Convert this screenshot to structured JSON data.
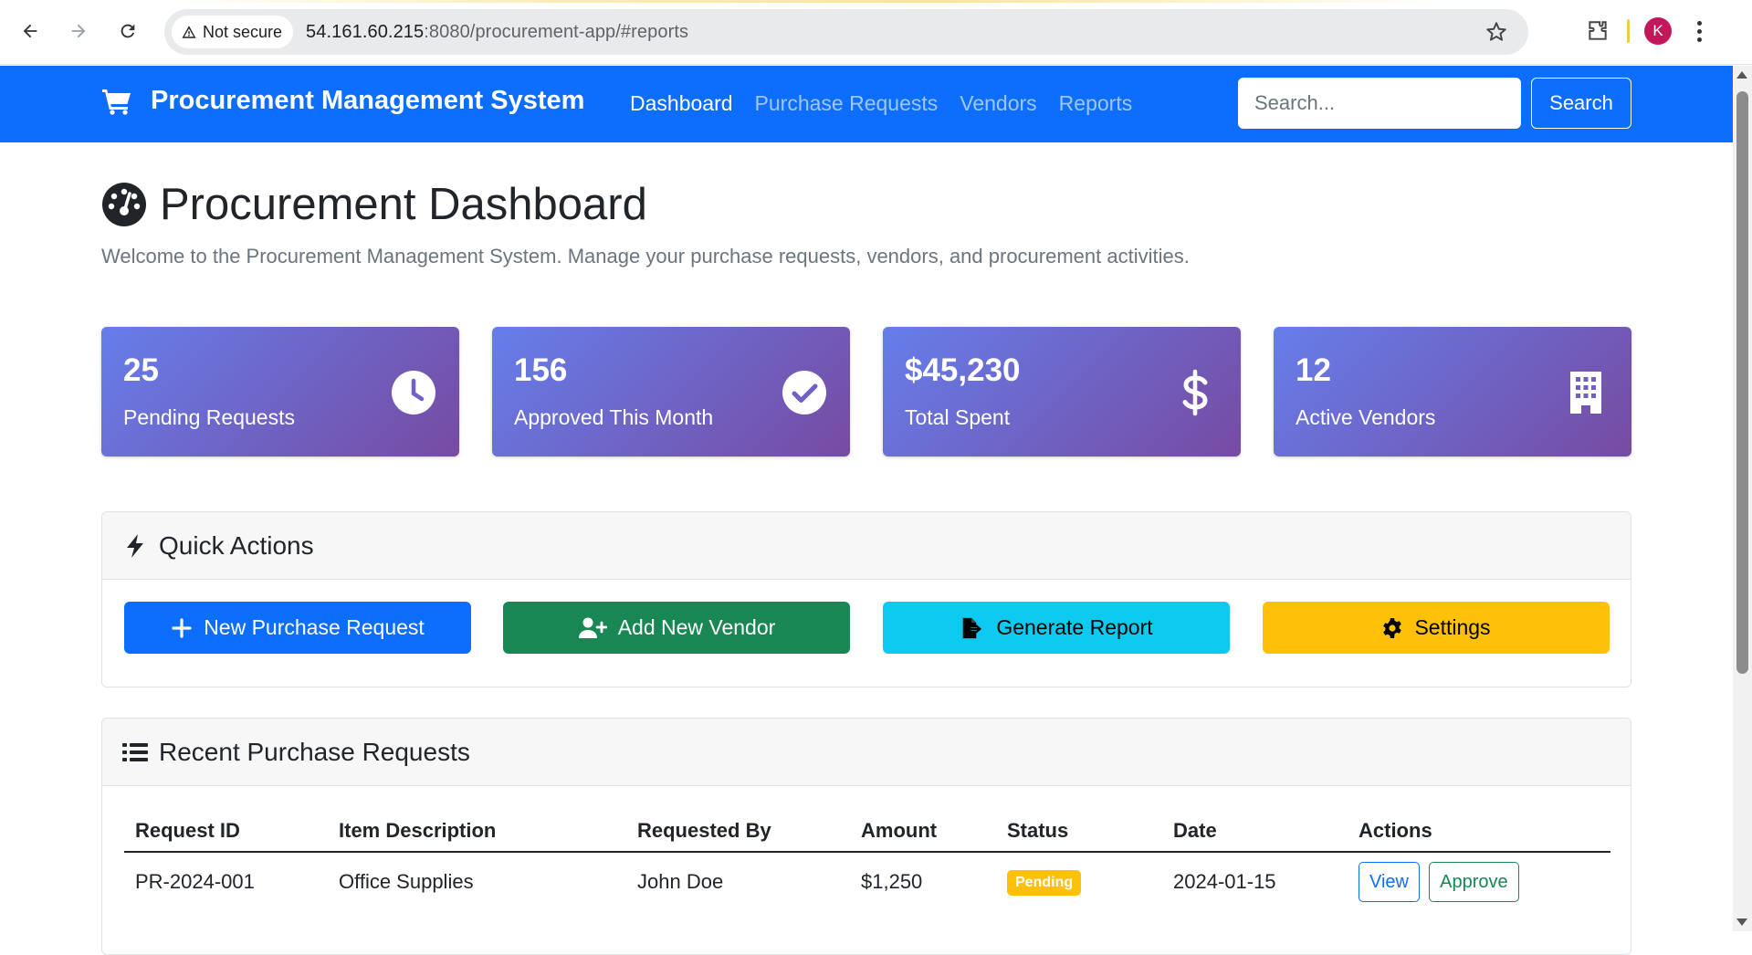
{
  "browser": {
    "security_label": "Not secure",
    "url_host": "54.161.60.215",
    "url_rest": ":8080/procurement-app/#reports",
    "profile_initial": "K"
  },
  "navbar": {
    "brand": "Procurement Management System",
    "links": [
      "Dashboard",
      "Purchase Requests",
      "Vendors",
      "Reports"
    ],
    "active_link": "Dashboard",
    "search_placeholder": "Search...",
    "search_button": "Search"
  },
  "page": {
    "title": "Procurement Dashboard",
    "subtitle": "Welcome to the Procurement Management System. Manage your purchase requests, vendors, and procurement activities."
  },
  "stats": [
    {
      "value": "25",
      "label": "Pending Requests",
      "icon": "clock-icon"
    },
    {
      "value": "156",
      "label": "Approved This Month",
      "icon": "check-circle-icon"
    },
    {
      "value": "$45,230",
      "label": "Total Spent",
      "icon": "dollar-icon"
    },
    {
      "value": "12",
      "label": "Active Vendors",
      "icon": "building-icon"
    }
  ],
  "quick_actions": {
    "title": "Quick Actions",
    "buttons": [
      {
        "label": "New Purchase Request",
        "icon": "plus-icon",
        "color": "#0d6efd"
      },
      {
        "label": "Add New Vendor",
        "icon": "user-plus-icon",
        "color": "#198754"
      },
      {
        "label": "Generate Report",
        "icon": "file-export-icon",
        "color": "#0dcaf0"
      },
      {
        "label": "Settings",
        "icon": "gear-icon",
        "color": "#ffc107"
      }
    ]
  },
  "recent_requests": {
    "title": "Recent Purchase Requests",
    "columns": [
      "Request ID",
      "Item Description",
      "Requested By",
      "Amount",
      "Status",
      "Date",
      "Actions"
    ],
    "rows": [
      {
        "id": "PR-2024-001",
        "item": "Office Supplies",
        "requested_by": "John Doe",
        "amount": "$1,250",
        "status": "Pending",
        "date": "2024-01-15",
        "actions": [
          "View",
          "Approve"
        ]
      }
    ]
  },
  "colors": {
    "primary": "#0d6efd",
    "success": "#198754",
    "info": "#0dcaf0",
    "warning": "#ffc107",
    "stat_gradient_start": "#667eea",
    "stat_gradient_end": "#764ba2"
  }
}
